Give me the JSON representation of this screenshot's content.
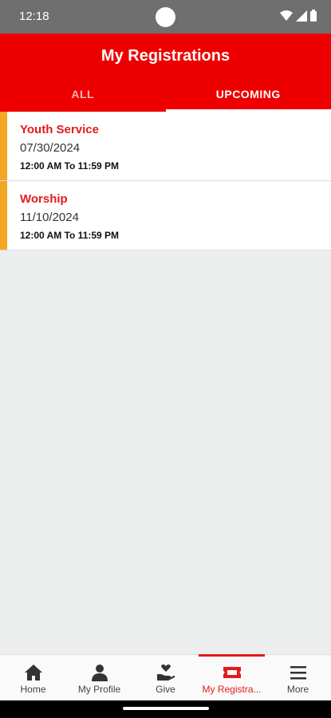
{
  "status_bar": {
    "time": "12:18"
  },
  "app_bar": {
    "title": "My Registrations"
  },
  "tabs": [
    {
      "label": "ALL",
      "active": false
    },
    {
      "label": "UPCOMING",
      "active": true
    }
  ],
  "registrations": [
    {
      "title": "Youth Service",
      "date": "07/30/2024",
      "time": "12:00 AM To 11:59 PM"
    },
    {
      "title": "Worship",
      "date": "11/10/2024",
      "time": "12:00 AM To 11:59 PM"
    }
  ],
  "bottom_nav": [
    {
      "label": "Home",
      "icon": "home-icon"
    },
    {
      "label": "My Profile",
      "icon": "person-icon"
    },
    {
      "label": "Give",
      "icon": "give-heart-icon"
    },
    {
      "label": "My Registra...",
      "icon": "ticket-icon",
      "active": true
    },
    {
      "label": "More",
      "icon": "menu-icon"
    }
  ],
  "colors": {
    "primary": "#ee0000",
    "accent": "#f5a623",
    "active_nav": "#e41b1b"
  }
}
